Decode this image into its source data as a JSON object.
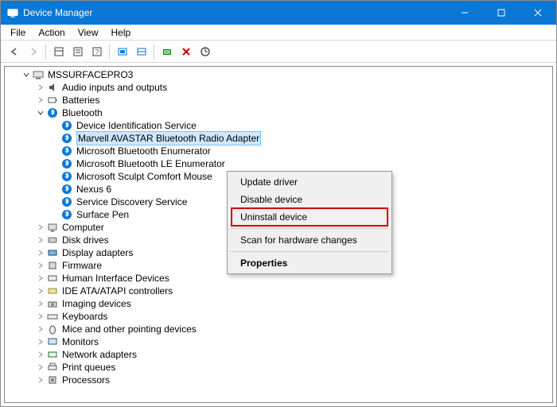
{
  "window": {
    "title": "Device Manager"
  },
  "menu": {
    "file": "File",
    "action": "Action",
    "view": "View",
    "help": "Help"
  },
  "tree": {
    "root": "MSSURFACEPRO3",
    "audio": "Audio inputs and outputs",
    "batteries": "Batteries",
    "bluetooth": "Bluetooth",
    "bt": {
      "dis": "Device Identification Service",
      "marvell": "Marvell AVASTAR Bluetooth Radio Adapter",
      "enum": "Microsoft Bluetooth Enumerator",
      "leenum": "Microsoft Bluetooth LE Enumerator",
      "mouse": "Microsoft Sculpt Comfort Mouse",
      "nexus": "Nexus 6",
      "sds": "Service Discovery Service",
      "pen": "Surface Pen"
    },
    "computer": "Computer",
    "diskdrives": "Disk drives",
    "display": "Display adapters",
    "firmware": "Firmware",
    "hid": "Human Interface Devices",
    "ide": "IDE ATA/ATAPI controllers",
    "imaging": "Imaging devices",
    "keyboards": "Keyboards",
    "mice": "Mice and other pointing devices",
    "monitors": "Monitors",
    "netadapters": "Network adapters",
    "printqueues": "Print queues",
    "processors": "Processors"
  },
  "context_menu": {
    "update": "Update driver",
    "disable": "Disable device",
    "uninstall": "Uninstall device",
    "scan": "Scan for hardware changes",
    "properties": "Properties"
  }
}
